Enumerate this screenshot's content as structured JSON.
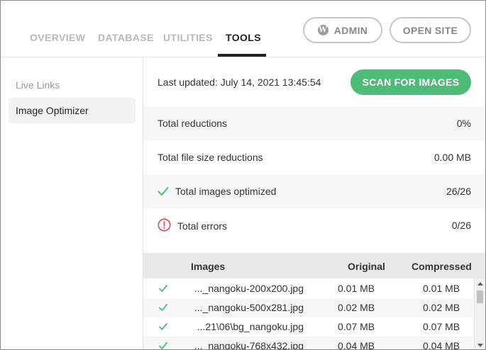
{
  "tabs": [
    {
      "label": "OVERVIEW",
      "active": false
    },
    {
      "label": "DATABASE",
      "active": false
    },
    {
      "label": "UTILITIES",
      "active": false
    },
    {
      "label": "TOOLS",
      "active": true
    }
  ],
  "header_buttons": {
    "admin_label": "ADMIN",
    "admin_icon": "wordpress-icon",
    "open_site_label": "OPEN SITE"
  },
  "sidebar": {
    "items": [
      {
        "label": "Live Links",
        "active": false
      },
      {
        "label": "Image Optimizer",
        "active": true
      }
    ]
  },
  "main": {
    "last_updated": "Last updated: July 14, 2021 13:45:54",
    "scan_button": "SCAN FOR IMAGES",
    "stats": [
      {
        "label": "Total reductions",
        "value": "0%",
        "icon": ""
      },
      {
        "label": "Total file size reductions",
        "value": "0.00 MB",
        "icon": ""
      },
      {
        "label": "Total images optimized",
        "value": "26/26",
        "icon": "check-icon"
      },
      {
        "label": "Total errors",
        "value": "0/26",
        "icon": "error-icon"
      }
    ],
    "table": {
      "columns": [
        "Images",
        "Original",
        "Compressed"
      ],
      "rows": [
        {
          "image": "..._nangoku-200x200.jpg",
          "original": "0.01 MB",
          "compressed": "0.01 MB"
        },
        {
          "image": "..._nangoku-500x281.jpg",
          "original": "0.02 MB",
          "compressed": "0.02 MB"
        },
        {
          "image": "...21\\06\\bg_nangoku.jpg",
          "original": "0.07 MB",
          "compressed": "0.07 MB"
        },
        {
          "image": "..._nangoku-768x432.jpg",
          "original": "0.04 MB",
          "compressed": "0.04 MB"
        }
      ]
    }
  },
  "colors": {
    "accent_green": "#4fbb78",
    "check_green": "#4fbb78",
    "error_red": "#e0455e"
  }
}
